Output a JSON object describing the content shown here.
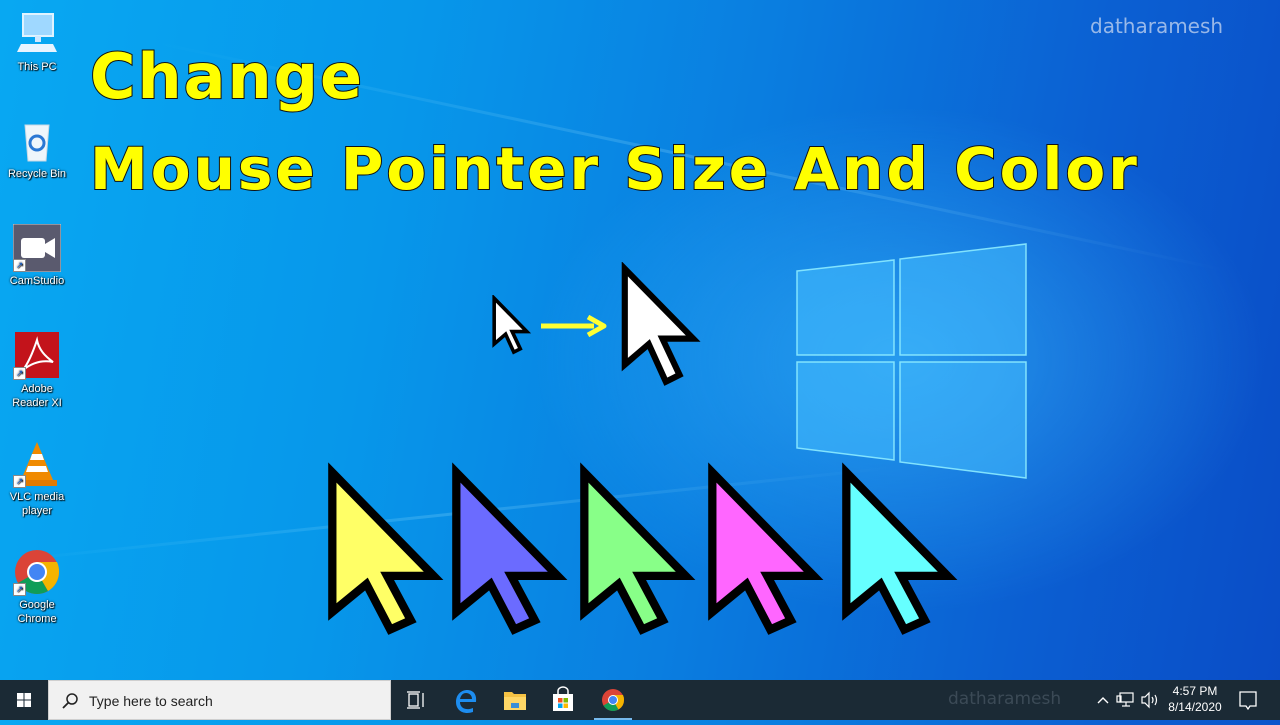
{
  "desktop": {
    "icons": [
      {
        "label": "This PC",
        "icon": "monitor-icon"
      },
      {
        "label": "Recycle Bin",
        "icon": "recycle-bin-icon"
      },
      {
        "label": "CamStudio",
        "icon": "camstudio-icon",
        "shortcut": true
      },
      {
        "label": "Adobe Reader XI",
        "icon": "adobe-reader-icon",
        "shortcut": true
      },
      {
        "label": "VLC media player",
        "icon": "vlc-cone-icon",
        "shortcut": true
      },
      {
        "label": "Google Chrome",
        "icon": "chrome-icon",
        "shortcut": true
      }
    ],
    "wallpaper_watermark": "datharamesh"
  },
  "overlay": {
    "title_line1": "Change",
    "title_line2": "Mouse Pointer Size And Color",
    "title_color": "#ffff00",
    "size_demo": {
      "small_cursor_color": "#ffffff",
      "arrow_color": "#ffff33",
      "large_cursor_color": "#ffffff"
    },
    "color_cursors": [
      {
        "name": "yellow",
        "color": "#ffff66"
      },
      {
        "name": "purple",
        "color": "#6b6bff"
      },
      {
        "name": "green",
        "color": "#88ff88"
      },
      {
        "name": "pink",
        "color": "#ff66ff"
      },
      {
        "name": "cyan",
        "color": "#66ffff"
      }
    ]
  },
  "taskbar": {
    "search_placeholder": "Type here to search",
    "pinned": [
      "task-view",
      "edge",
      "file-explorer",
      "microsoft-store",
      "chrome"
    ],
    "watermark": "datharamesh",
    "time": "4:57 PM",
    "date": "8/14/2020",
    "background": "#1b2a35"
  }
}
